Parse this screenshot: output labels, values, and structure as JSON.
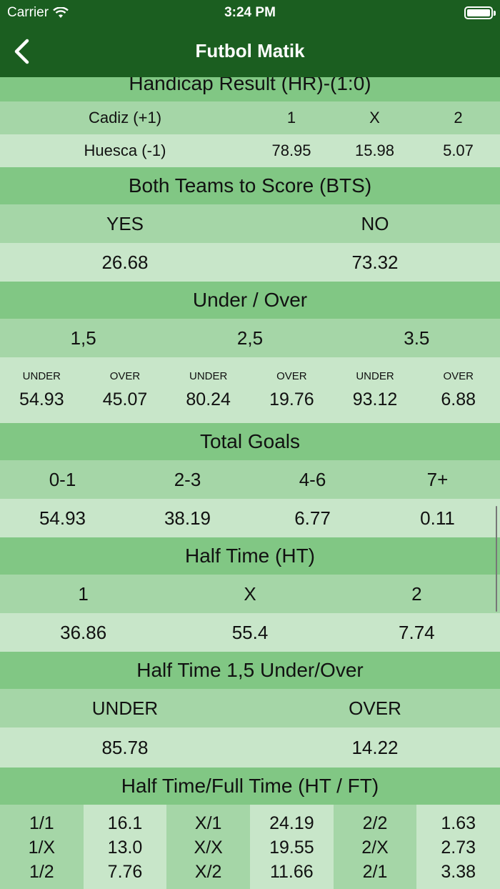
{
  "status_bar": {
    "carrier": "Carrier",
    "time": "3:24 PM"
  },
  "nav": {
    "title": "Futbol Matik"
  },
  "handicap": {
    "title": "Handicap Result (HR)-(1:0)",
    "header_row": [
      "Cadiz (+1)",
      "1",
      "X",
      "2"
    ],
    "value_row": [
      "Huesca (-1)",
      "78.95",
      "15.98",
      "5.07"
    ]
  },
  "bts": {
    "title": "Both Teams to Score (BTS)",
    "labels": [
      "YES",
      "NO"
    ],
    "values": [
      "26.68",
      "73.32"
    ]
  },
  "under_over": {
    "title": "Under / Over",
    "lines": [
      "1,5",
      "2,5",
      "3.5"
    ],
    "pairs": [
      {
        "under_label": "UNDER",
        "under": "54.93",
        "over_label": "OVER",
        "over": "45.07"
      },
      {
        "under_label": "UNDER",
        "under": "80.24",
        "over_label": "OVER",
        "over": "19.76"
      },
      {
        "under_label": "UNDER",
        "under": "93.12",
        "over_label": "OVER",
        "over": "6.88"
      }
    ]
  },
  "total_goals": {
    "title": "Total Goals",
    "labels": [
      "0-1",
      "2-3",
      "4-6",
      "7+"
    ],
    "values": [
      "54.93",
      "38.19",
      "6.77",
      "0.11"
    ]
  },
  "half_time": {
    "title": "Half Time (HT)",
    "labels": [
      "1",
      "X",
      "2"
    ],
    "values": [
      "36.86",
      "55.4",
      "7.74"
    ]
  },
  "ht_under_over": {
    "title": "Half Time 1,5 Under/Over",
    "labels": [
      "UNDER",
      "OVER"
    ],
    "values": [
      "85.78",
      "14.22"
    ]
  },
  "htft": {
    "title": "Half Time/Full Time (HT / FT)",
    "columns": [
      [
        "1/1",
        "1/X",
        "1/2"
      ],
      [
        "16.1",
        "13.0",
        "7.76"
      ],
      [
        "X/1",
        "X/X",
        "X/2"
      ],
      [
        "24.19",
        "19.55",
        "11.66"
      ],
      [
        "2/2",
        "2/X",
        "2/1"
      ],
      [
        "1.63",
        "2.73",
        "3.38"
      ]
    ]
  }
}
